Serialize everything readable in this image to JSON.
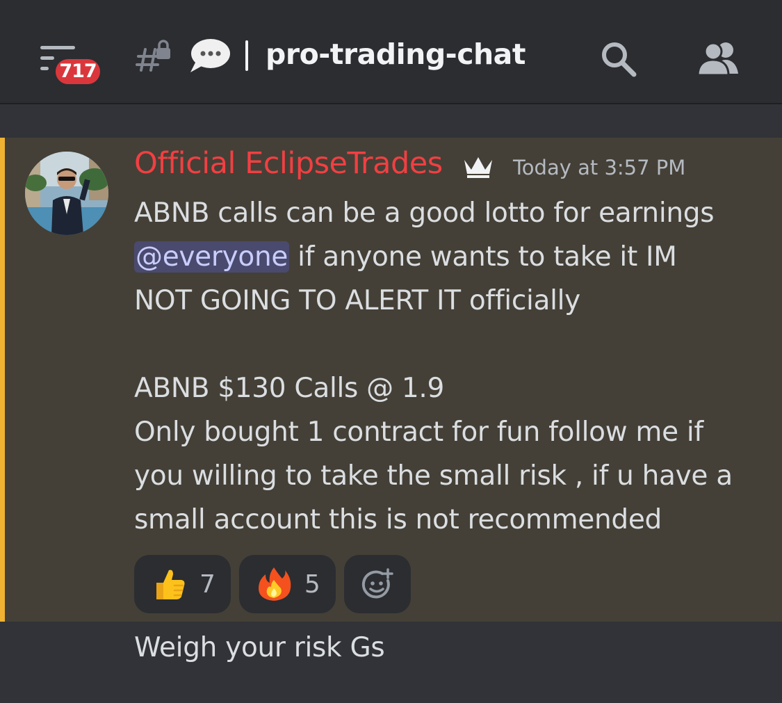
{
  "header": {
    "unread_badge": "717",
    "channel_name": "pro-trading-chat",
    "icons": {
      "menu": "hamburger-menu-icon",
      "channel": "locked-hashtag-icon",
      "bubble": "speech-bubble-icon",
      "search": "search-icon",
      "members": "members-icon"
    }
  },
  "message": {
    "author": "Official EclipseTrades",
    "author_color": "#f23f42",
    "timestamp": "Today at 3:57 PM",
    "highlight_color": "#f0b232",
    "lines": {
      "l1": "ABNB calls can be a good lotto for earnings",
      "mention": "@everyone",
      "l2_rest": " if anyone wants to take it IM",
      "l3": "NOT GOING TO ALERT IT officially",
      "l4": "ABNB $130 Calls @ 1.9",
      "l5": "Only bought 1 contract for fun follow me if",
      "l6": "you willing to take the small risk , if u have a",
      "l7": "small account this is not recommended"
    },
    "reactions": [
      {
        "emoji": "thumbs-up",
        "count": "7"
      },
      {
        "emoji": "fire",
        "count": "5"
      }
    ]
  },
  "next_message": {
    "text": "Weigh your risk Gs"
  }
}
